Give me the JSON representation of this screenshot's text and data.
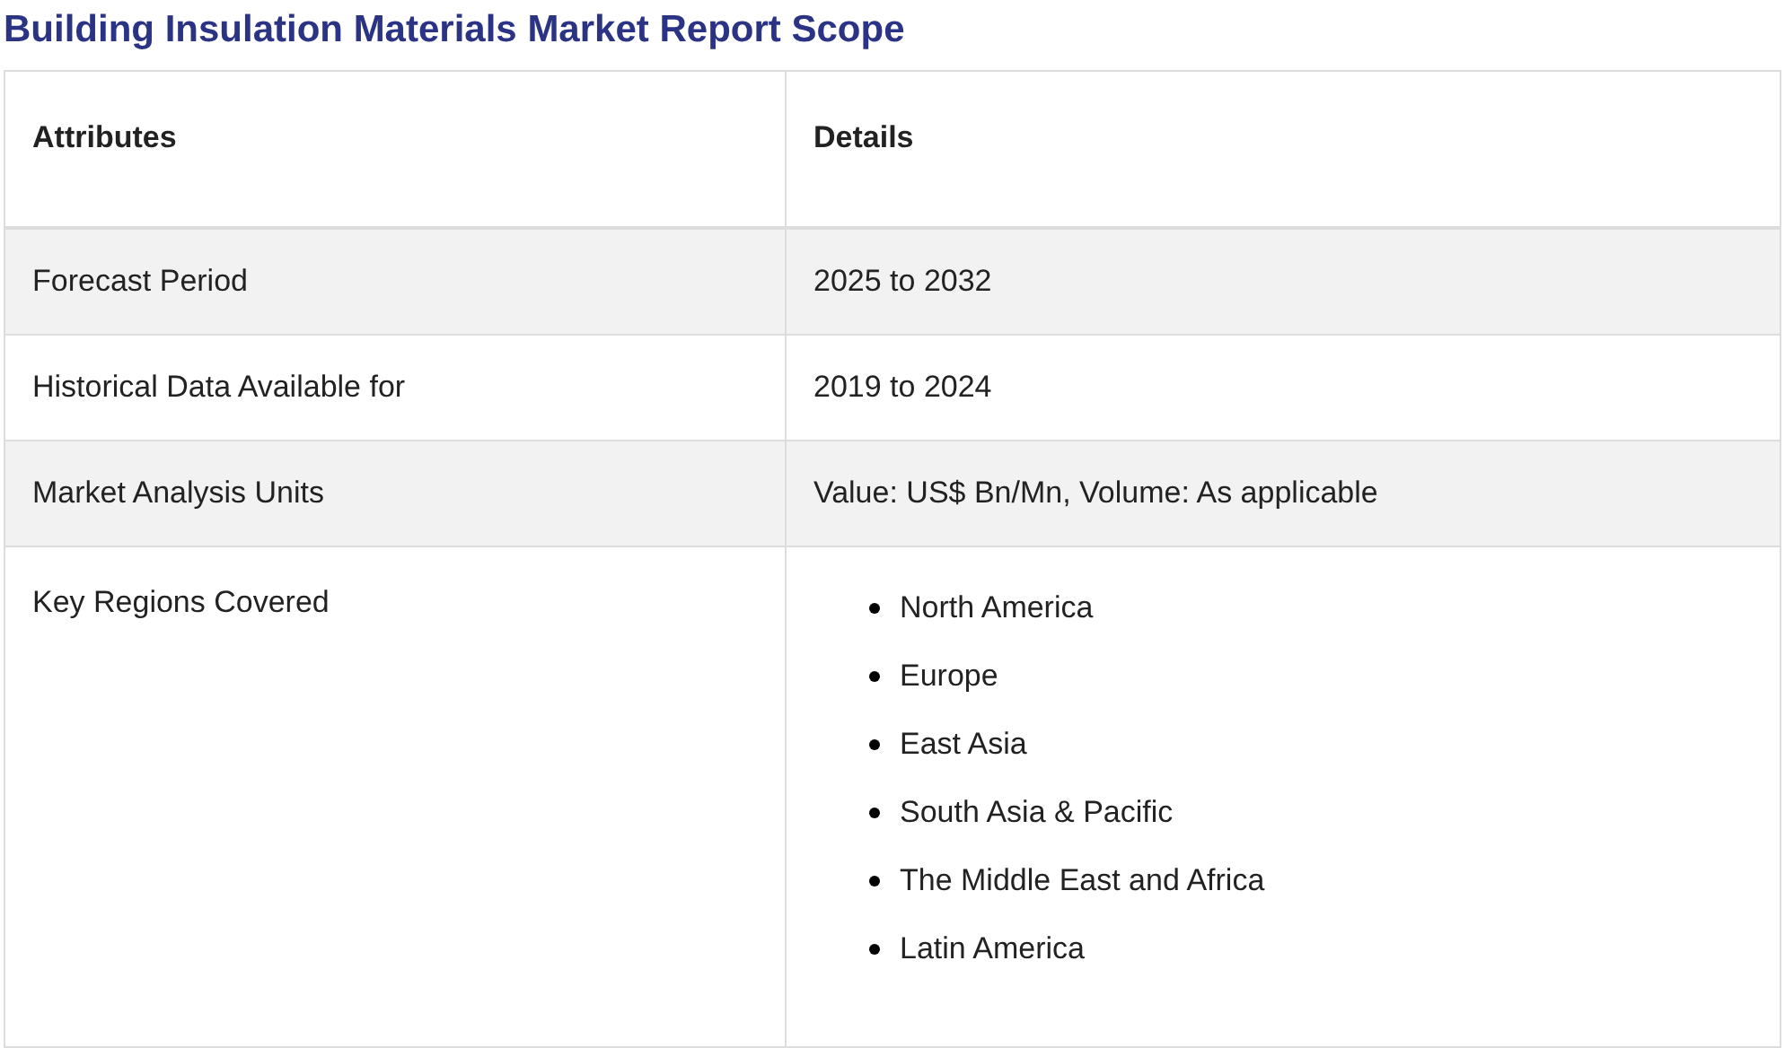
{
  "title": "Building Insulation Materials Market Report Scope",
  "table": {
    "columns": [
      "Attributes",
      "Details"
    ],
    "rows": [
      {
        "attribute": "Forecast Period",
        "kind": "text",
        "details": "2025 to 2032"
      },
      {
        "attribute": "Historical Data Available for",
        "kind": "text",
        "details": "2019 to 2024"
      },
      {
        "attribute": "Market Analysis Units",
        "kind": "text",
        "details": "Value: US$ Bn/Mn, Volume: As applicable"
      },
      {
        "attribute": "Key Regions Covered",
        "kind": "list",
        "items": [
          "North America",
          "Europe",
          "East Asia",
          "South Asia & Pacific",
          "The Middle East and Africa",
          "Latin America"
        ]
      }
    ]
  }
}
